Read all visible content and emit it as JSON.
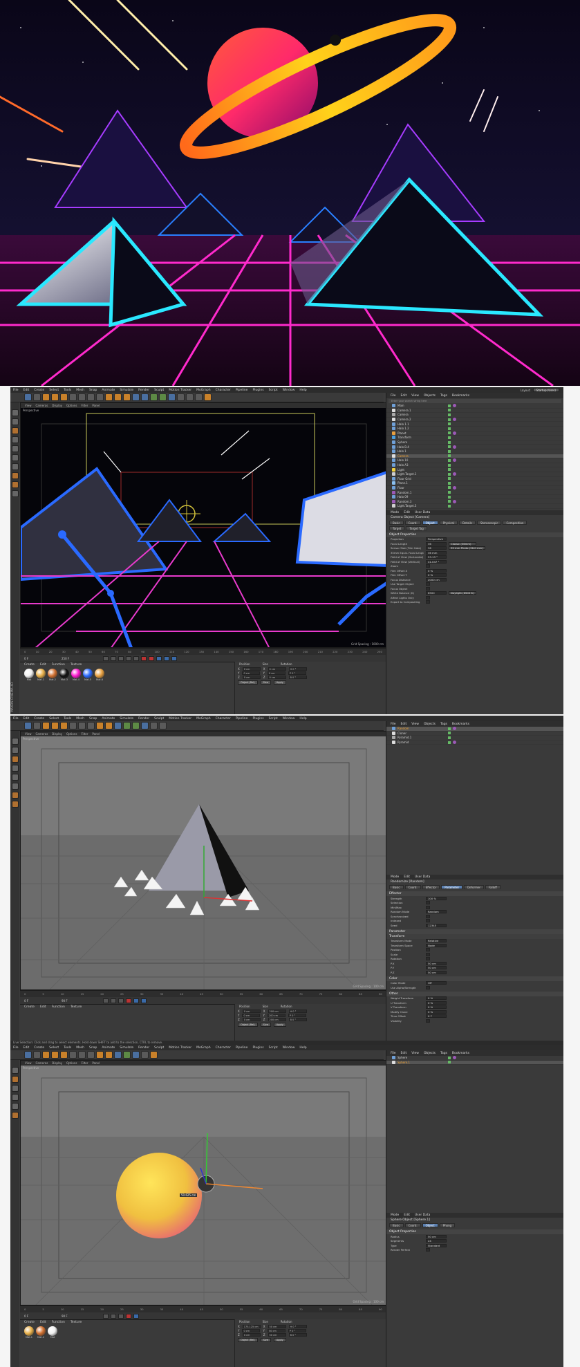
{
  "menu_items": [
    "File",
    "Edit",
    "Create",
    "Select",
    "Tools",
    "Mesh",
    "Snap",
    "Animate",
    "Simulate",
    "Render",
    "Sculpt",
    "Motion Tracker",
    "MoGraph",
    "Character",
    "Pipeline",
    "Plugins",
    "Script",
    "Window",
    "Help"
  ],
  "menu_items_f3": [
    "File",
    "Edit",
    "Create",
    "Select",
    "Tools",
    "Mesh",
    "Snap",
    "Animate",
    "Simulate",
    "Render",
    "Sculpt",
    "Motion Tracker",
    "MoGraph",
    "Character",
    "Pipeline",
    "Plugins",
    "Script",
    "Window",
    "Help"
  ],
  "layout": {
    "label": "Layout:",
    "value": "Startup (User)"
  },
  "viewport": {
    "menu": [
      "View",
      "Cameras",
      "Display",
      "Options",
      "Filter",
      "Panel"
    ],
    "label": "Perspective",
    "grid_spacing_f2": "Grid Spacing : 1000 cm",
    "grid_spacing_f3": "Grid Spacing : 100 cm",
    "grid_spacing_f4": "Grid Spacing : 100 cm"
  },
  "timeline_ticks": [
    "0",
    "10",
    "20",
    "30",
    "40",
    "50",
    "60",
    "70",
    "80",
    "90",
    "100",
    "110",
    "120",
    "130",
    "140",
    "150",
    "160",
    "170",
    "180",
    "190",
    "200",
    "210",
    "220",
    "230",
    "240",
    "250"
  ],
  "timeline_ticks_f3": [
    "0",
    "5",
    "10",
    "15",
    "20",
    "25",
    "30",
    "35",
    "40",
    "45",
    "50",
    "55",
    "60",
    "65",
    "70",
    "75",
    "80",
    "85",
    "90"
  ],
  "material_menu": [
    "Create",
    "Edit",
    "Function",
    "Texture"
  ],
  "materials_f2": [
    "Mat",
    "Mat.1",
    "Mat.2",
    "Mat.3",
    "Mat.4",
    "Mat.5",
    "Mat.6"
  ],
  "materials_f4": [
    "Mat.1",
    "Mat.2",
    "Mat"
  ],
  "coords": {
    "headers": [
      "Position",
      "Size",
      "Rotation"
    ],
    "axes": [
      "X",
      "Y",
      "Z"
    ],
    "pos_f2": [
      "0 cm",
      "0 cm",
      "0 cm"
    ],
    "size_f2": [
      "0 cm",
      "0 cm",
      "0 cm"
    ],
    "rot_f2": [
      "H 0 °",
      "P 0 °",
      "B 0 °"
    ],
    "pos_f3": [
      "0 cm",
      "0 cm",
      "0 cm"
    ],
    "size_f3": [
      "200 cm",
      "200 cm",
      "200 cm"
    ],
    "rot_f3": [
      "H 0 °",
      "P 0 °",
      "B 0 °"
    ],
    "pos_f4": [
      "175.125 cm",
      "0 cm",
      "0 cm"
    ],
    "size_f4": [
      "50 cm",
      "50 cm",
      "50 cm"
    ],
    "rot_f4": [
      "H 0 °",
      "P 0 °",
      "B 0 °"
    ],
    "mode_a": "Object (Rel)",
    "mode_b": "Size",
    "apply": "Apply"
  },
  "object_manager": {
    "menu": [
      "File",
      "Edit",
      "View",
      "Objects",
      "Tags",
      "Bookmarks"
    ],
    "search": "Enter your search string here",
    "objects_f2": [
      "Main",
      "Camera.1",
      "Camera",
      "Camera.2",
      "Halo 1.1",
      "Halo 1.2",
      "Planet",
      "Transform",
      "Sphere",
      "Halo B.4",
      "Halo 1",
      "Camera",
      "Halo 10",
      "Halo A3",
      "Light",
      "Light.Target.1",
      "Floor Grid",
      "Plane.1",
      "Floor",
      "Random.1",
      "Halo 09",
      "Random.3",
      "Light.Target.3"
    ],
    "objects_f3": [
      "Random",
      "Cloner",
      "Pyramid.1",
      "Pyramid"
    ],
    "objects_f4": [
      "Sphere",
      "Sphere.1"
    ]
  },
  "attributes": {
    "menu": [
      "Mode",
      "Edit",
      "User Data"
    ],
    "f2": {
      "title": "Camera Object [Camera]",
      "tabs": [
        "Basic",
        "Coord.",
        "Object",
        "Physical",
        "Details",
        "Stereoscopic",
        "Composition"
      ],
      "tabs2": [
        "Target",
        "Target Tag"
      ],
      "active_tab": "Object",
      "section": "Object Properties",
      "props": [
        [
          "Projection",
          "Perspective"
        ],
        [
          "Focal Length",
          "36",
          "Classic (36mm)"
        ],
        [
          "Sensor Size (Film Gate)",
          "36",
          "35 mm Photo (36.0 mm)"
        ],
        [
          "35mm Equiv. Focal Length:",
          "36 mm"
        ],
        [
          "Field of View (Horizontal)",
          "53.13 °"
        ],
        [
          "Field of View (Vertical)",
          "41.047 °"
        ],
        [
          "Zoom",
          ""
        ],
        [
          "Film Offset X",
          "0 %"
        ],
        [
          "Film Offset Y",
          "0 %"
        ],
        [
          "Focus Distance",
          "2000 cm"
        ],
        [
          "Use Target Object",
          ""
        ],
        [
          "Focus Object",
          ""
        ],
        [
          "White Balance (K)",
          "6500",
          "Daylight (6500 K)"
        ],
        [
          "Affect Lights Only",
          ""
        ],
        [
          "Export to Compositing",
          ""
        ]
      ]
    },
    "f3": {
      "title": "Randomize [Random]",
      "tabs": [
        "Basic",
        "Coord.",
        "Effector",
        "Parameter",
        "Deformer",
        "Falloff"
      ],
      "active_tab": "Parameter",
      "section": "Effector",
      "props": [
        [
          "Strength",
          "100 %"
        ],
        [
          "Selection",
          ""
        ],
        [
          "Min/Max",
          ""
        ],
        [
          "Random Mode",
          "Random"
        ],
        [
          "Synchronized",
          ""
        ],
        [
          "Indexed",
          ""
        ],
        [
          "Seed",
          "12345"
        ]
      ],
      "section2": "Parameter",
      "sub": "Transform",
      "props2": [
        [
          "Transform Mode",
          "Relative"
        ],
        [
          "Transform Space",
          "Node"
        ],
        [
          "Position",
          ""
        ],
        [
          "Scale",
          ""
        ],
        [
          "Rotation",
          ""
        ],
        [
          "P.X",
          "50 cm"
        ],
        [
          "P.Y",
          "50 cm"
        ],
        [
          "P.Z",
          "50 cm"
        ]
      ],
      "section3": "Color",
      "props3": [
        [
          "Color Mode",
          "Off"
        ],
        [
          "Use Alpha/Strength",
          ""
        ]
      ],
      "section4": "Other",
      "props4": [
        [
          "Weight Transform",
          "0 %"
        ],
        [
          "U Transform",
          "0 %"
        ],
        [
          "V Transform",
          "0 %"
        ],
        [
          "Modify Clone",
          "0 %"
        ],
        [
          "Time Offset",
          "0 F"
        ],
        [
          "Visibility",
          ""
        ]
      ]
    },
    "f4": {
      "title": "Sphere Object [Sphere.1]",
      "tabs": [
        "Basic",
        "Coord.",
        "Object",
        "Phong"
      ],
      "active_tab": "Object",
      "section": "Object Properties",
      "props": [
        [
          "Radius",
          "50 cm"
        ],
        [
          "Segments",
          "24"
        ],
        [
          "Type",
          "Standard"
        ],
        [
          "Render Perfect",
          ""
        ]
      ]
    }
  },
  "statusbar_f3": "Live Selection: Click and drag to select elements. Hold down SHIFT to add to the selection, CTRL to remove.",
  "size_label_f4": "50.625 cm",
  "brand": "MAXON CINEMA 4D",
  "frame_f2": "0 F",
  "frame_end_f2": "250 F",
  "frame_f3": "0 F",
  "frame_end_f3": "90 F",
  "frame_f4": "0 F",
  "frame_end_f4": "90 F"
}
